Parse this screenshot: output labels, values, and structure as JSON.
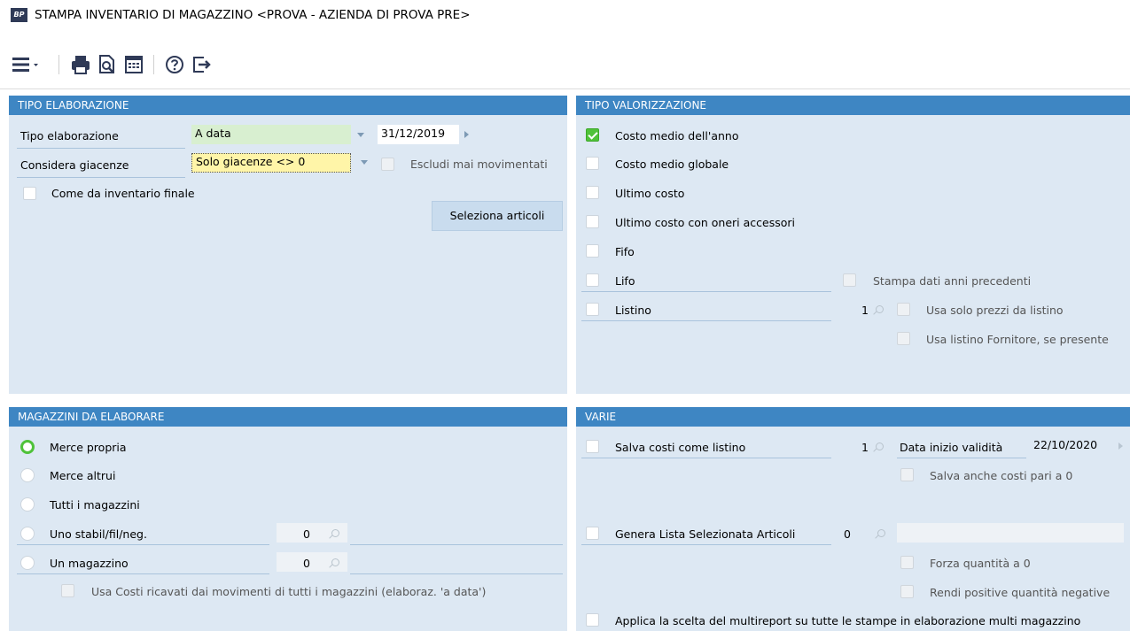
{
  "window": {
    "app_icon": "BP",
    "title": "STAMPA INVENTARIO DI MAGAZZINO <PROVA - AZIENDA DI PROVA PRE>"
  },
  "toolbar": {
    "icons": [
      "menu-icon",
      "print-icon",
      "print-preview-icon",
      "calculator-icon",
      "help-icon",
      "exit-icon"
    ]
  },
  "tipo_elaborazione": {
    "header": "TIPO ELABORAZIONE",
    "tipo_label": "Tipo elaborazione",
    "tipo_value": "A data",
    "date_value": "31/12/2019",
    "giacenze_label": "Considera giacenze",
    "giacenze_value": "Solo giacenze <> 0",
    "escludi_label": "Escludi mai movimentati",
    "come_inventario_label": "Come da inventario finale",
    "seleziona_button": "Seleziona articoli"
  },
  "tipo_valorizzazione": {
    "header": "TIPO VALORIZZAZIONE",
    "options": [
      "Costo medio dell'anno",
      "Costo medio globale",
      "Ultimo costo",
      "Ultimo costo con oneri accessori",
      "Fifo",
      "Lifo",
      "Listino"
    ],
    "stampa_dati_label": "Stampa dati anni precedenti",
    "listino_number": "1",
    "usa_solo_prezzi_label": "Usa solo prezzi da listino",
    "usa_listino_fornitore_label": "Usa listino Fornitore, se presente"
  },
  "magazzini": {
    "header": "MAGAZZINI DA ELABORARE",
    "options": [
      "Merce propria",
      "Merce altrui",
      "Tutti i magazzini",
      "Uno stabil/fil/neg.",
      "Un magazzino"
    ],
    "stabil_number": "0",
    "magazzino_number": "0",
    "usa_costi_label": "Usa Costi ricavati dai movimenti di tutti i magazzini (elaboraz. 'a data')"
  },
  "varie": {
    "header": "VARIE",
    "salva_costi_label": "Salva costi come listino",
    "salva_costi_number": "1",
    "data_inizio_label": "Data inizio validità",
    "data_inizio_value": "22/10/2020",
    "salva_anche_label": "Salva anche costi pari a 0",
    "genera_lista_label": "Genera Lista Selezionata Articoli",
    "genera_lista_number": "0",
    "forza_label": "Forza quantità a 0",
    "rendi_label": "Rendi positive quantità negative",
    "applica_label": "Applica la scelta del multireport su tutte le stampe in elaborazione multi magazzino"
  },
  "colors": {
    "header_blue": "#3e86c3",
    "panel_bg": "#dde8f3",
    "check_green": "#4fc23a",
    "field_green": "#d8efd0",
    "field_yellow": "#fff5a8"
  }
}
